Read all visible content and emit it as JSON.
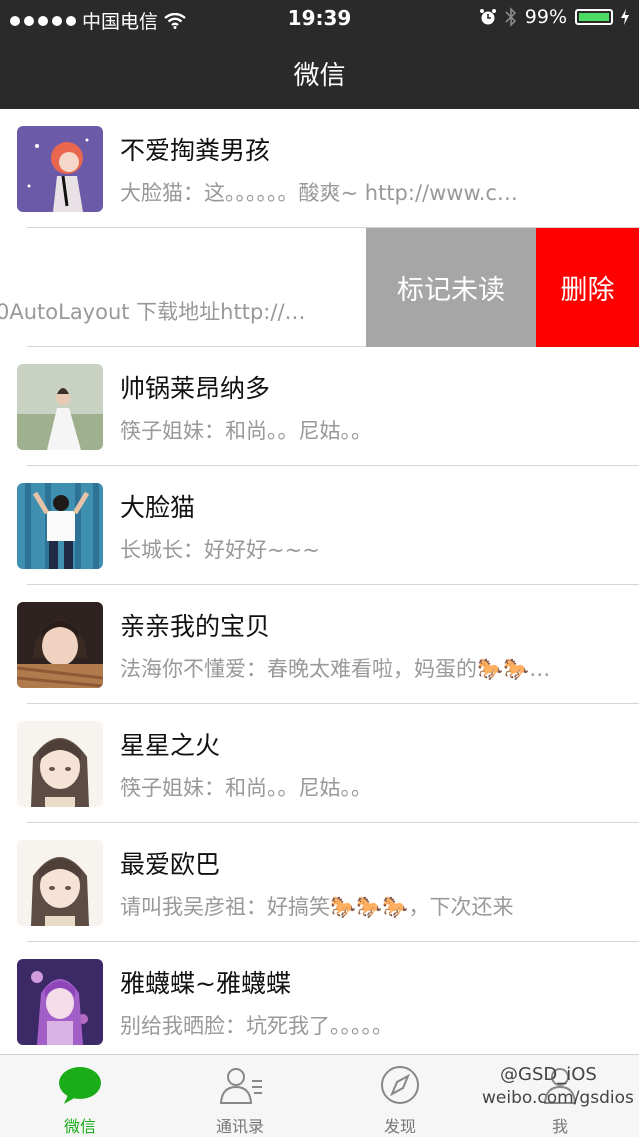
{
  "status_bar": {
    "carrier": "中国电信",
    "time": "19:39",
    "battery_text": "99%",
    "battery_level": 0.99
  },
  "nav": {
    "title": "微信"
  },
  "swipe_actions": {
    "mark_unread": "标记未读",
    "delete": "删除"
  },
  "chats": [
    {
      "name": "不爱掏粪男孩",
      "message": "大脸猫：这。。。。。。酸爽~ http://www.c…"
    },
    {
      "name": "",
      "message": "0AutoLayout  下载地址http://…"
    },
    {
      "name": "帅锅莱昂纳多",
      "message": "筷子姐妹：和尚。。尼姑。。"
    },
    {
      "name": "大脸猫",
      "message": "长城长：好好好~~~"
    },
    {
      "name": "亲亲我的宝贝",
      "message": "法海你不懂爱：春晚太难看啦，妈蛋的🐎🐎…"
    },
    {
      "name": "星星之火",
      "message": "筷子姐妹：和尚。。尼姑。。"
    },
    {
      "name": "最爱欧巴",
      "message": "请叫我吴彦祖：好搞笑🐎🐎🐎，下次还来"
    },
    {
      "name": "雅蠛蝶~雅蠛蝶",
      "message": "别给我晒脸：坑死我了。。。。。"
    }
  ],
  "tabs": [
    {
      "label": "微信",
      "icon": "chat-bubble-icon"
    },
    {
      "label": "通讯录",
      "icon": "contacts-icon"
    },
    {
      "label": "发现",
      "icon": "compass-icon"
    },
    {
      "label": "我",
      "icon": "person-icon"
    }
  ],
  "watermark": {
    "line1": "@GSD_iOS",
    "line2": "weibo.com/gsdios"
  },
  "colors": {
    "accent": "#1aad19",
    "delete": "#ff0000",
    "mark": "#a6a6a6",
    "nav": "#2a2a2a"
  }
}
